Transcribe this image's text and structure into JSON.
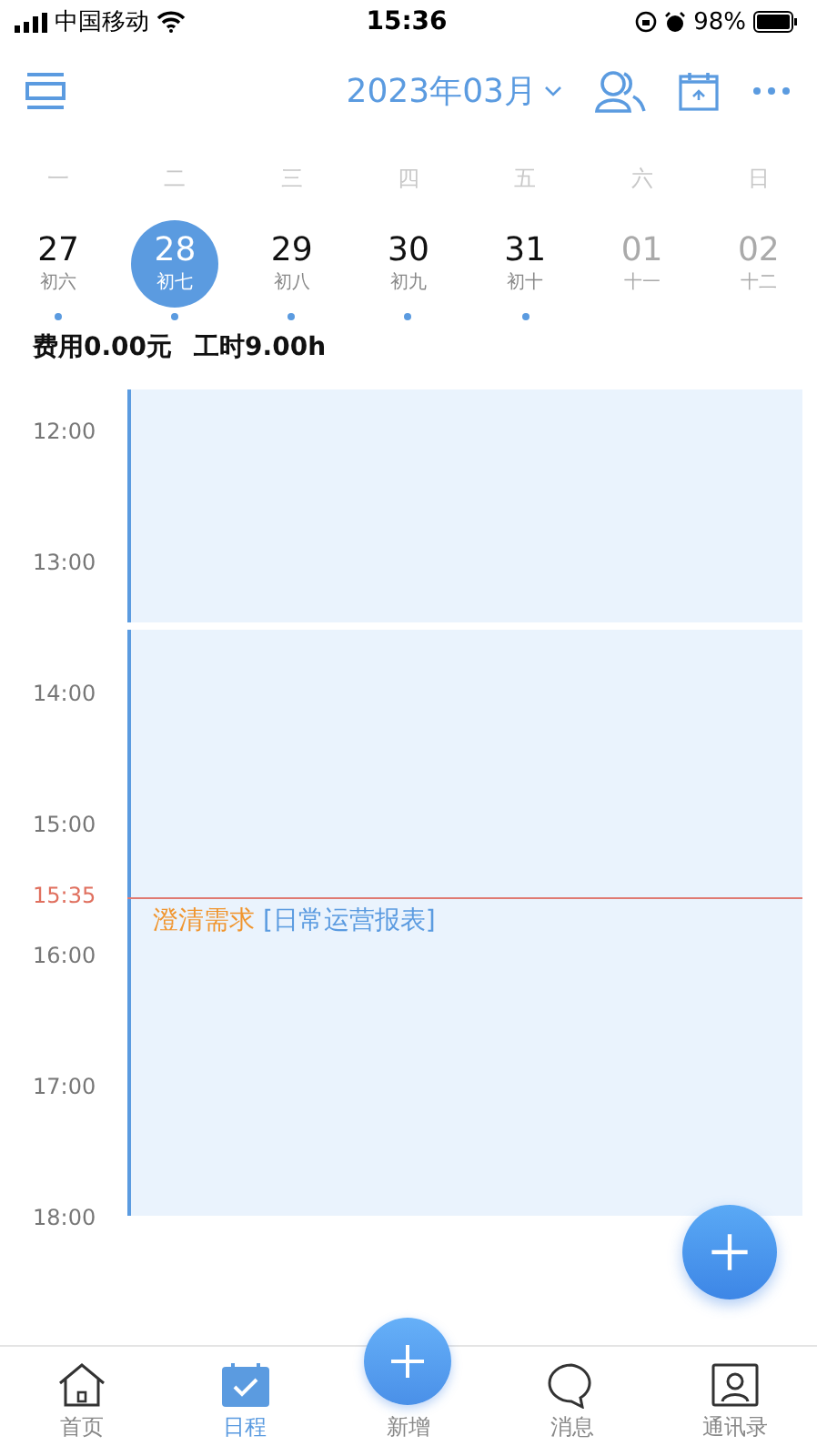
{
  "status_bar": {
    "carrier": "中国移动",
    "time": "15:36",
    "battery": "98%"
  },
  "header": {
    "month": "2023年03月"
  },
  "weekdays": [
    "一",
    "二",
    "三",
    "四",
    "五",
    "六",
    "日"
  ],
  "days": [
    {
      "date": "27",
      "lunar": "初六",
      "selected": false,
      "other_month": false,
      "has_events": true
    },
    {
      "date": "28",
      "lunar": "初七",
      "selected": true,
      "other_month": false,
      "has_events": true
    },
    {
      "date": "29",
      "lunar": "初八",
      "selected": false,
      "other_month": false,
      "has_events": true
    },
    {
      "date": "30",
      "lunar": "初九",
      "selected": false,
      "other_month": false,
      "has_events": true
    },
    {
      "date": "31",
      "lunar": "初十",
      "selected": false,
      "other_month": false,
      "has_events": true
    },
    {
      "date": "01",
      "lunar": "十一",
      "selected": false,
      "other_month": true,
      "has_events": false
    },
    {
      "date": "02",
      "lunar": "十二",
      "selected": false,
      "other_month": true,
      "has_events": false
    }
  ],
  "summary": {
    "cost": "费用0.00元",
    "hours": "工时9.00h"
  },
  "timeline": {
    "hours": [
      "12:00",
      "13:00",
      "14:00",
      "15:00",
      "16:00",
      "17:00",
      "18:00"
    ],
    "now": "15:35",
    "event": {
      "title": "澄清需求",
      "project": "[日常运营报表]"
    }
  },
  "tabs": [
    {
      "kind": "home",
      "label": "首页",
      "selected": false
    },
    {
      "kind": "schedule",
      "label": "日程",
      "selected": true
    },
    {
      "kind": "add",
      "label": "新增",
      "selected": false
    },
    {
      "kind": "messages",
      "label": "消息",
      "selected": false
    },
    {
      "kind": "contacts",
      "label": "通讯录",
      "selected": false
    }
  ]
}
